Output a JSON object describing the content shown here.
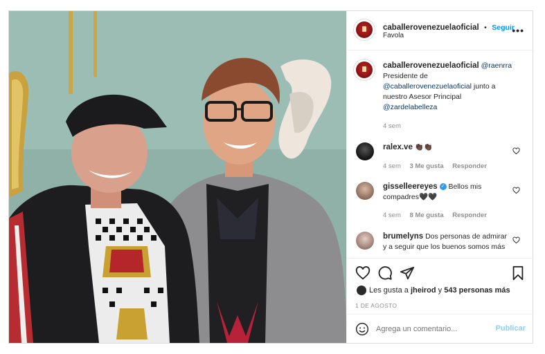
{
  "header": {
    "username": "caballerovenezuelaoficial",
    "separator": "•",
    "follow_label": "Seguir",
    "location": "Favola",
    "more_icon": "more-horizontal-icon"
  },
  "caption": {
    "username": "caballerovenezuelaoficial",
    "mention": "@raenrra",
    "line1": "Presidente de",
    "mention2": "@caballerovenezuelaoficial",
    "line2": " junto a",
    "line3": "nuestro Asesor Principal",
    "mention3": "@zardelabelleza",
    "time": "4 sem"
  },
  "comments": [
    {
      "username": "ralex.ve",
      "text": "👏🏿👏🏿",
      "time": "4 sem",
      "likes": "",
      "reply": "Responder"
    },
    {
      "username": "gisselleereyes",
      "verified": true,
      "text": "Bellos mis compadres🖤🖤",
      "time": "4 sem",
      "likes": "8 Me gusta",
      "reply": "Responder"
    },
    {
      "username": "brumelyns",
      "text": "Dos personas de admirar y a seguir que los buenos somos más",
      "time": "",
      "likes": "",
      "reply": ""
    }
  ],
  "comment1_likes": "3 Me gusta",
  "actions": {
    "icons": [
      "heart-icon",
      "comment-icon",
      "share-icon",
      "bookmark-icon"
    ],
    "likes_prefix": "Les gusta a ",
    "likes_user": "jheirod",
    "likes_suffix": " y ",
    "likes_count": "543 personas más",
    "date": "1 DE AGOSTO"
  },
  "add_comment": {
    "placeholder": "Agrega un comentario...",
    "publish_label": "Publicar",
    "emoji_icon": "smile-icon"
  },
  "colors": {
    "link": "#00376b",
    "accent": "#0095f6",
    "secondary": "#8e8e8e",
    "brand_avatar": "#8e1414"
  }
}
